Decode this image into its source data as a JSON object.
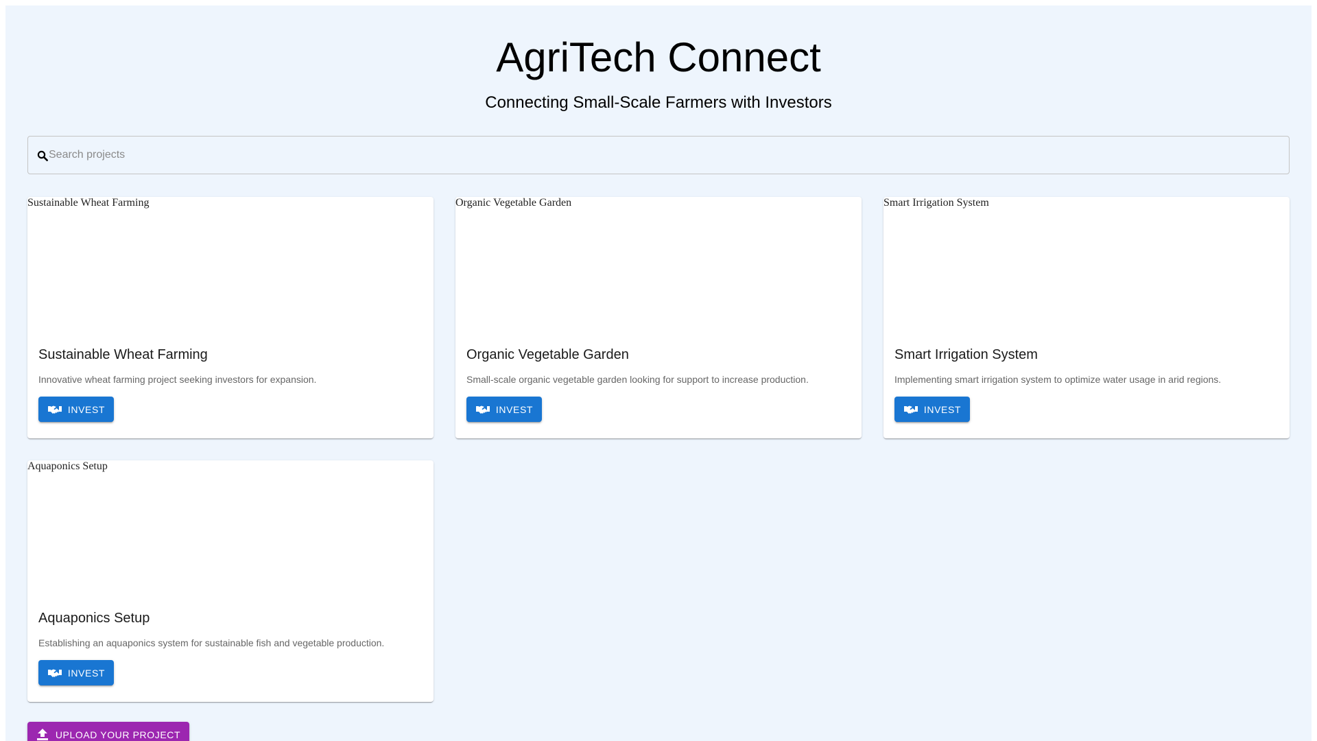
{
  "header": {
    "title": "AgriTech Connect",
    "subtitle": "Connecting Small-Scale Farmers with Investors"
  },
  "search": {
    "placeholder": "Search projects",
    "value": "",
    "icon": "search-icon"
  },
  "projects": [
    {
      "image_alt": "Sustainable Wheat Farming",
      "title": "Sustainable Wheat Farming",
      "description": "Innovative wheat farming project seeking investors for expansion.",
      "button_label": "Invest"
    },
    {
      "image_alt": "Organic Vegetable Garden",
      "title": "Organic Vegetable Garden",
      "description": "Small-scale organic vegetable garden looking for support to increase production.",
      "button_label": "Invest"
    },
    {
      "image_alt": "Smart Irrigation System",
      "title": "Smart Irrigation System",
      "description": "Implementing smart irrigation system to optimize water usage in arid regions.",
      "button_label": "Invest"
    },
    {
      "image_alt": "Aquaponics Setup",
      "title": "Aquaponics Setup",
      "description": "Establishing an aquaponics system for sustainable fish and vegetable production.",
      "button_label": "Invest"
    }
  ],
  "upload": {
    "label": "Upload Your Project",
    "icon": "upload-icon"
  },
  "colors": {
    "background": "#eef5fd",
    "primary": "#1976d2",
    "secondary": "#9c27b0",
    "card": "#ffffff",
    "description_text": "#666666"
  }
}
